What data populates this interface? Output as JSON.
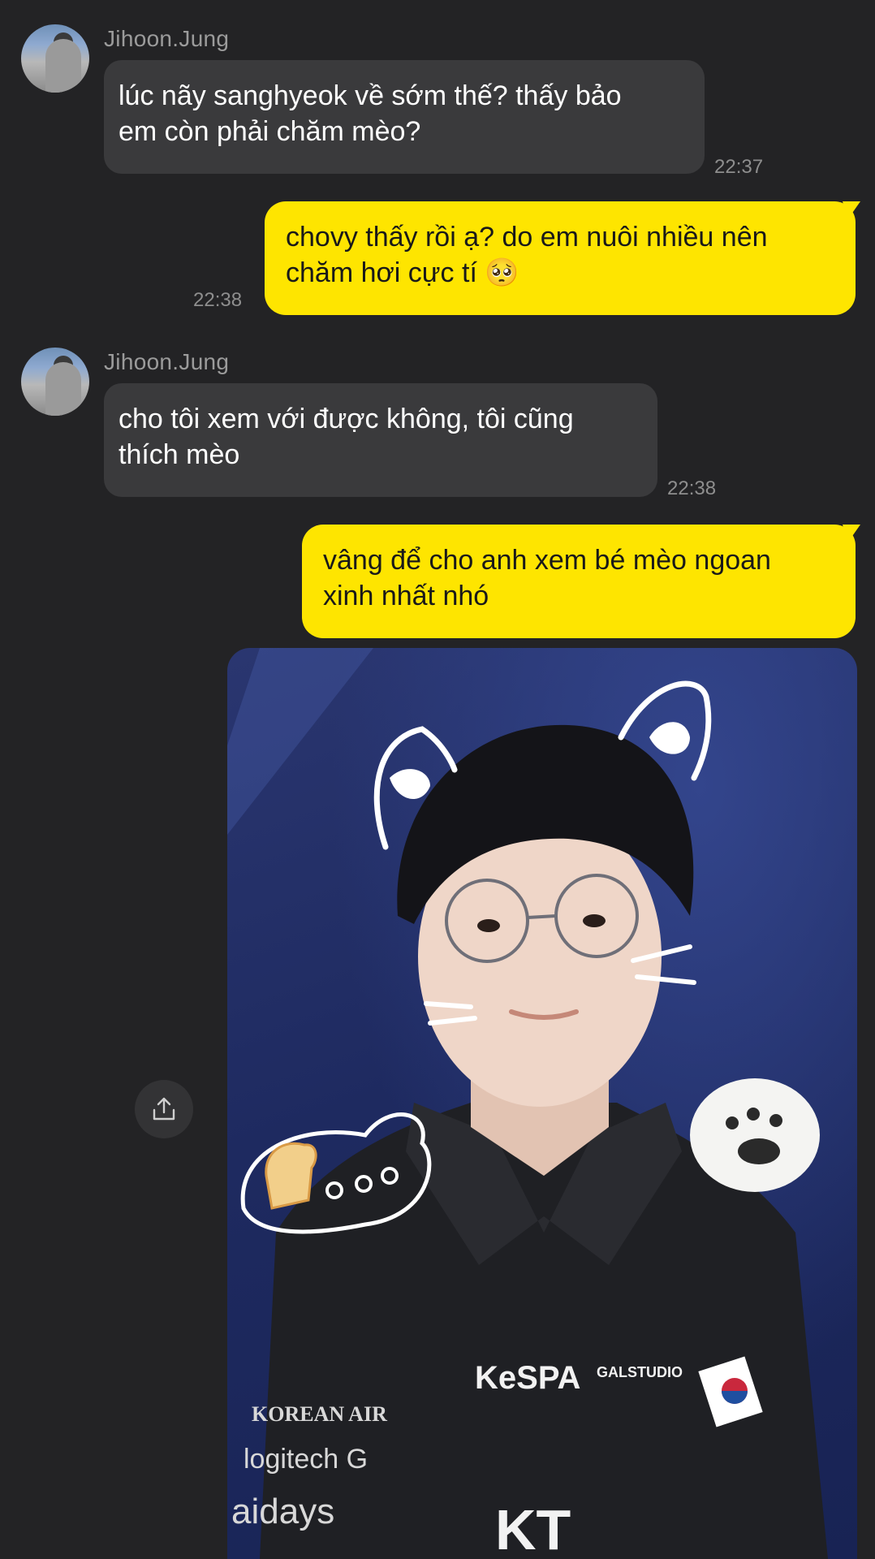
{
  "messages": [
    {
      "sender": "Jihoon.Jung",
      "line1": "lúc nãy sanghyeok về sớm thế? thấy bảo",
      "line2": "em còn phải chăm mèo?",
      "time": "22:37"
    },
    {
      "line1": "chovy thấy rồi ạ? do em nuôi nhiều nên",
      "line2": "chăm hơi cực tí",
      "emoji": "🥺",
      "time": "22:38"
    },
    {
      "sender": "Jihoon.Jung",
      "line1": "cho tôi xem với được không, tôi cũng",
      "line2": "thích mèo",
      "time": "22:38"
    },
    {
      "line1": "vâng để cho anh xem bé mèo ngoan",
      "line2": "xinh nhất nhó"
    }
  ],
  "photo": {
    "jersey_text": [
      "KeSPA",
      "GALSTUDIO",
      "KOREAN AIR",
      "logitech G",
      "aidays"
    ]
  },
  "colors": {
    "background": "#232325",
    "incoming_bubble": "#3a3a3c",
    "outgoing_bubble": "#fee500"
  },
  "icons": {
    "share": "share-icon"
  }
}
